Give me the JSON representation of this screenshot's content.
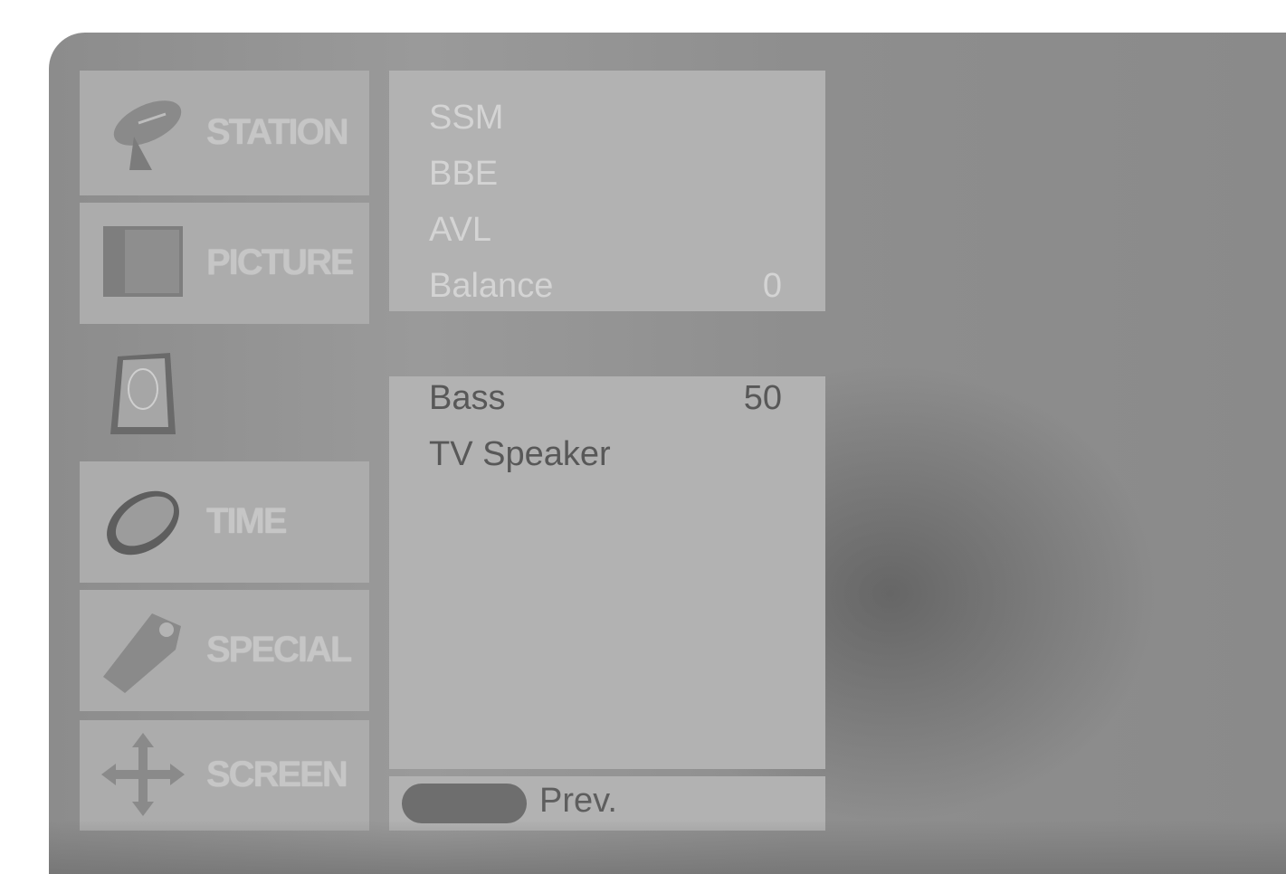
{
  "sidebar": {
    "items": [
      {
        "label": "STATION",
        "icon": "satellite-dish-icon"
      },
      {
        "label": "PICTURE",
        "icon": "picture-monitor-icon"
      },
      {
        "label": "",
        "icon": "speaker-icon",
        "active": true
      },
      {
        "label": "TIME",
        "icon": "clock-icon"
      },
      {
        "label": "SPECIAL",
        "icon": "tag-icon"
      },
      {
        "label": "SCREEN",
        "icon": "move-arrows-icon"
      }
    ]
  },
  "upper_panel": {
    "rows": [
      {
        "label": "SSM",
        "value": ""
      },
      {
        "label": "BBE",
        "value": ""
      },
      {
        "label": "AVL",
        "value": ""
      },
      {
        "label": "Balance",
        "value": "0"
      }
    ]
  },
  "lower_panel": {
    "rows": [
      {
        "label": "Bass",
        "value": "50"
      },
      {
        "label": "TV Speaker",
        "value": ""
      }
    ]
  },
  "footer": {
    "prev_label": "Prev."
  }
}
